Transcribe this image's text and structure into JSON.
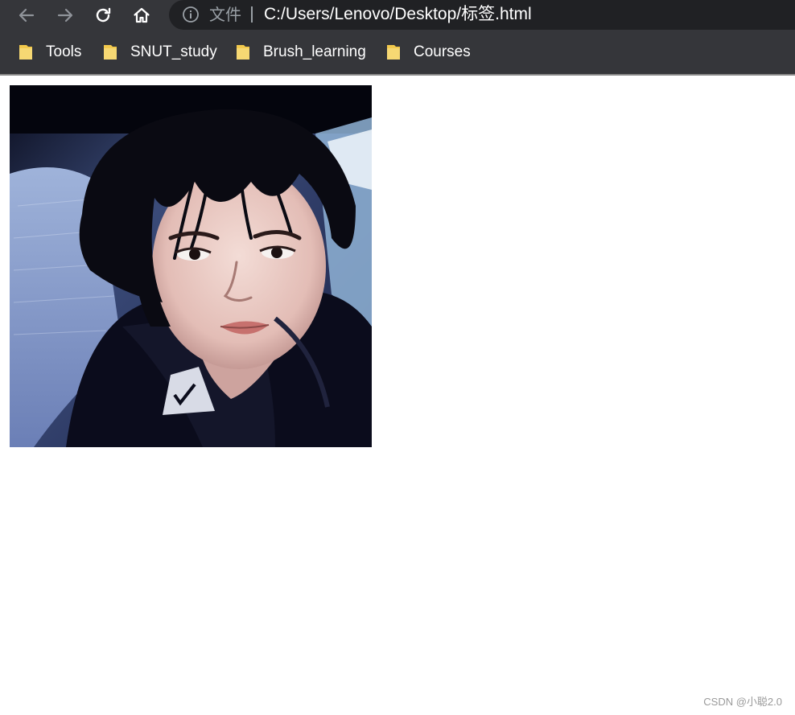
{
  "browser": {
    "nav": {
      "back_icon": "arrow-left-icon",
      "forward_icon": "arrow-right-icon",
      "reload_icon": "reload-icon",
      "home_icon": "home-icon"
    },
    "omnibox": {
      "info_icon": "info-icon",
      "scheme_label": "文件",
      "url": "C:/Users/Lenovo/Desktop/标签.html"
    },
    "bookmarks": [
      {
        "label": "Tools",
        "icon": "folder-icon"
      },
      {
        "label": "SNUT_study",
        "icon": "folder-icon"
      },
      {
        "label": "Brush_learning",
        "icon": "folder-icon"
      },
      {
        "label": "Courses",
        "icon": "folder-icon"
      }
    ],
    "colors": {
      "chrome": "#35363a",
      "omnibox": "#202124",
      "folder": "#f2c94c"
    }
  },
  "page": {
    "image": {
      "kind": "portrait-photo"
    },
    "watermark": "CSDN @小聪2.0"
  }
}
